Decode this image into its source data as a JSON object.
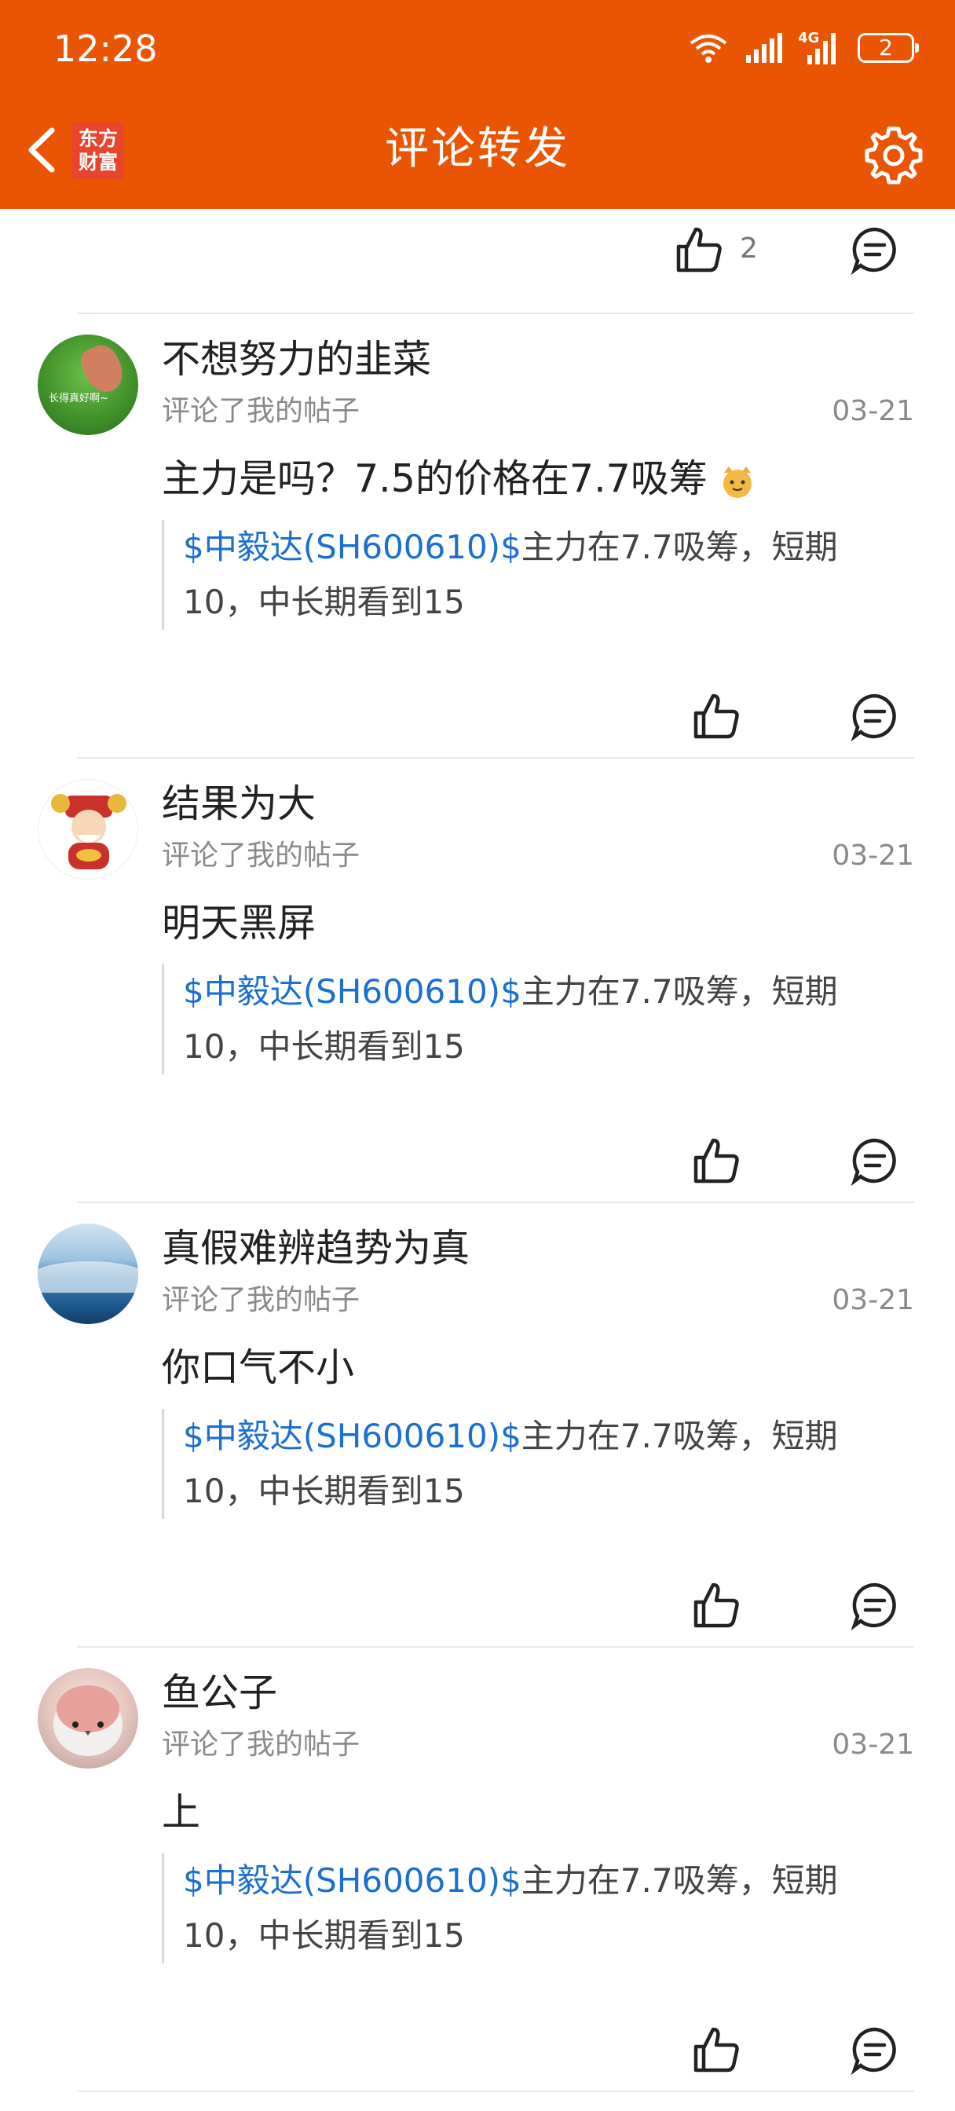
{
  "status_bar": {
    "time": "12:28",
    "signal_label": "4G",
    "battery": "2"
  },
  "header": {
    "title": "评论转发",
    "logo_text_line1": "东方",
    "logo_text_line2": "财富"
  },
  "top_item": {
    "like_count": "2"
  },
  "comments": [
    {
      "username": "不想努力的韭菜",
      "meta": "评论了我的帖子",
      "date": "03-21",
      "text": "主力是吗？7.5的价格在7.7吸筹",
      "has_emoji": true,
      "quote_link": "$中毅达(SH600610)$",
      "quote_text": "主力在7.7吸筹，短期10，中长期看到15",
      "avatar_caption": "长得真好啊~"
    },
    {
      "username": "结果为大",
      "meta": "评论了我的帖子",
      "date": "03-21",
      "text": "明天黑屏",
      "has_emoji": false,
      "quote_link": "$中毅达(SH600610)$",
      "quote_text": "主力在7.7吸筹，短期10，中长期看到15"
    },
    {
      "username": "真假难辨趋势为真",
      "meta": "评论了我的帖子",
      "date": "03-21",
      "text": "你口气不小",
      "has_emoji": false,
      "quote_link": "$中毅达(SH600610)$",
      "quote_text": "主力在7.7吸筹，短期10，中长期看到15"
    },
    {
      "username": "鱼公子",
      "meta": "评论了我的帖子",
      "date": "03-21",
      "text": "上",
      "has_emoji": false,
      "quote_link": "$中毅达(SH600610)$",
      "quote_text": "主力在7.7吸筹，短期10，中长期看到15"
    }
  ],
  "colors": {
    "header_bg": "#ea5504",
    "link": "#1a6fd1",
    "meta": "#8a8a8a"
  }
}
